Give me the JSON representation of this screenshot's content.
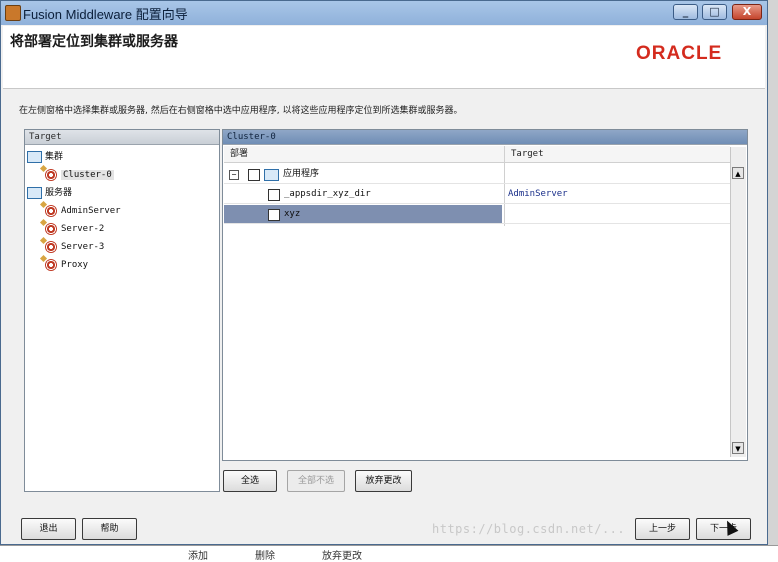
{
  "window": {
    "title": "Fusion Middleware 配置向导",
    "minimize": "_",
    "maximize": "□",
    "close": "X"
  },
  "header": {
    "title": "将部署定位到集群或服务器",
    "logo": "ORACLE"
  },
  "instruction": "在左侧窗格中选择集群或服务器, 然后在右侧窗格中选中应用程序, 以将这些应用程序定位到所选集群或服务器。",
  "left_panel": {
    "header": "Target",
    "tree": [
      {
        "label": "集群",
        "type": "folder"
      },
      {
        "label": "Cluster-0",
        "type": "target",
        "selected": true
      },
      {
        "label": "服务器",
        "type": "folder"
      },
      {
        "label": "AdminServer",
        "type": "target"
      },
      {
        "label": "Server-2",
        "type": "target"
      },
      {
        "label": "Server-3",
        "type": "target"
      },
      {
        "label": "Proxy",
        "type": "target"
      }
    ]
  },
  "right_panel": {
    "header": "Cluster-0",
    "columns": [
      "部署",
      "Target"
    ],
    "expander": "−",
    "rows": [
      {
        "name": "应用程序",
        "target": "",
        "folder": true
      },
      {
        "name": "_appsdir_xyz_dir",
        "target": "AdminServer"
      },
      {
        "name": "xyz",
        "target": "",
        "selected": true
      }
    ]
  },
  "actions": {
    "select_all": "全选",
    "deselect_all": "全部不选",
    "discard": "放弃更改"
  },
  "footer": {
    "exit": "退出",
    "help": "帮助",
    "back": "上一步",
    "next": "下一步"
  },
  "watermark": "https://blog.csdn.net/...",
  "taskbar": {
    "add": "添加",
    "delete": "删除",
    "discard": "放弃更改"
  }
}
